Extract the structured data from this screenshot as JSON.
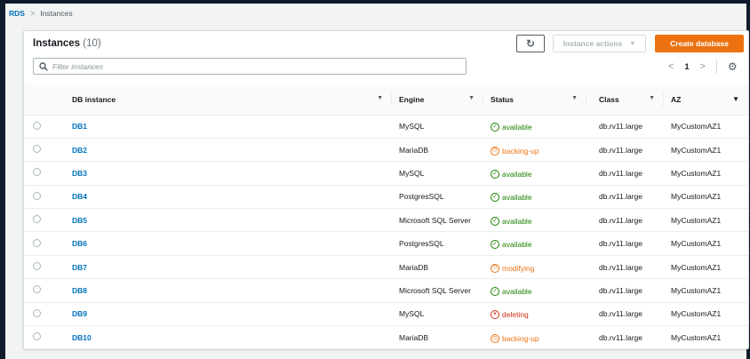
{
  "breadcrumb": {
    "root": "RDS",
    "separator": ">",
    "current": "Instances"
  },
  "panel": {
    "title": "Instances",
    "count": "(10)",
    "refresh_icon": "refresh-icon",
    "actions_label": "Instance actions",
    "create_label": "Create database"
  },
  "filter": {
    "placeholder": "Filter instances",
    "value": ""
  },
  "pager": {
    "prev": "<",
    "page": "1",
    "next": ">",
    "settings_icon": "gear-icon"
  },
  "columns": [
    "DB instance",
    "Engine",
    "Status",
    "Class",
    "AZ"
  ],
  "colors": {
    "accent": "#ec7211",
    "link": "#0073bb",
    "available": "#1d8102",
    "warning": "#ec7211",
    "error": "#d13212"
  },
  "rows": [
    {
      "name": "DB1",
      "engine": "MySQL",
      "status": "available",
      "status_kind": "available",
      "class": "db.rv11.large",
      "az": "MyCustomAZ1"
    },
    {
      "name": "DB2",
      "engine": "MariaDB",
      "status": "backing-up",
      "status_kind": "warn",
      "class": "db.rv11.large",
      "az": "MyCustomAZ1"
    },
    {
      "name": "DB3",
      "engine": "MySQL",
      "status": "available",
      "status_kind": "available",
      "class": "db.rv11.large",
      "az": "MyCustomAZ1"
    },
    {
      "name": "DB4",
      "engine": "PostgresSQL",
      "status": "available",
      "status_kind": "available",
      "class": "db.rv11.large",
      "az": "MyCustomAZ1"
    },
    {
      "name": "DB5",
      "engine": "Microsoft SQL Server",
      "status": "available",
      "status_kind": "available",
      "class": "db.rv11.large",
      "az": "MyCustomAZ1"
    },
    {
      "name": "DB6",
      "engine": "PostgresSQL",
      "status": "available",
      "status_kind": "available",
      "class": "db.rv11.large",
      "az": "MyCustomAZ1"
    },
    {
      "name": "DB7",
      "engine": "MariaDB",
      "status": "modifying",
      "status_kind": "warn",
      "class": "db.rv11.large",
      "az": "MyCustomAZ1"
    },
    {
      "name": "DB8",
      "engine": "Microsoft SQL Server",
      "status": "available",
      "status_kind": "available",
      "class": "db.rv11.large",
      "az": "MyCustomAZ1"
    },
    {
      "name": "DB9",
      "engine": "MySQL",
      "status": "deleting",
      "status_kind": "deleting",
      "class": "db.rv11.large",
      "az": "MyCustomAZ1"
    },
    {
      "name": "DB10",
      "engine": "MariaDB",
      "status": "backing-up",
      "status_kind": "warn",
      "class": "db.rv11.large",
      "az": "MyCustomAZ1"
    }
  ]
}
